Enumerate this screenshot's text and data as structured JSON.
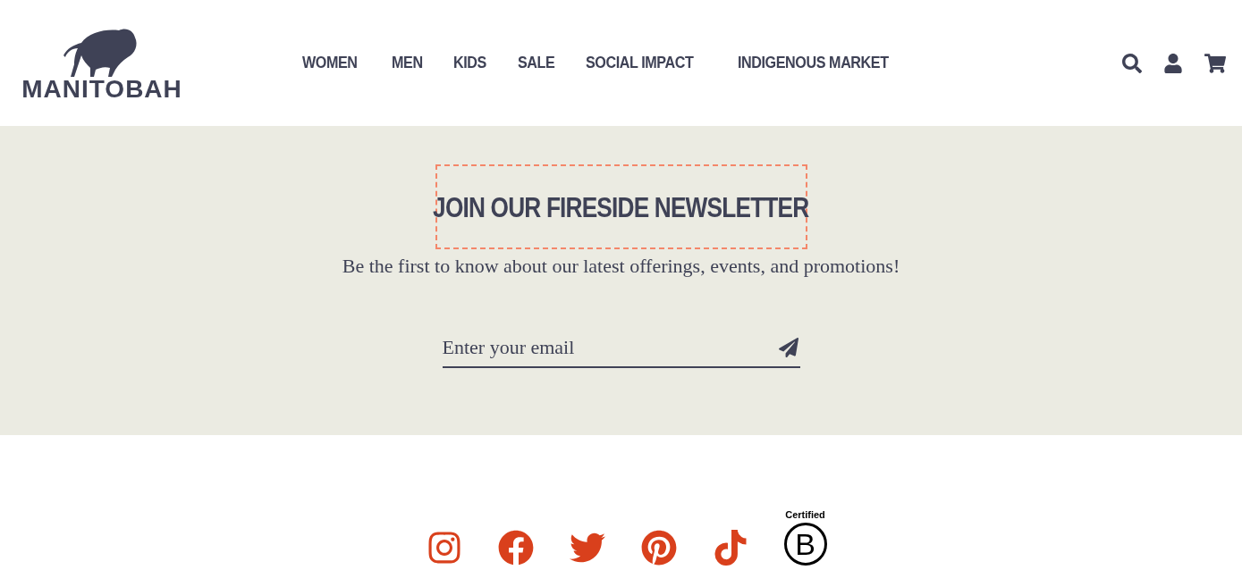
{
  "header": {
    "logo": "MANITOBAH",
    "nav": [
      {
        "label": "WOMEN"
      },
      {
        "label": "MEN"
      },
      {
        "label": "KIDS"
      },
      {
        "label": "SALE"
      },
      {
        "label": "SOCIAL IMPACT"
      },
      {
        "label": "INDIGENOUS MARKET"
      }
    ]
  },
  "newsletter": {
    "title": "JOIN OUR FIRESIDE NEWSLETTER",
    "focused": true,
    "text": "Be the first to know about our latest offerings, events, and promotions!",
    "email": {
      "placeholder": "Enter your email"
    }
  },
  "footer": {
    "socials": [
      {
        "kind": "instagram"
      },
      {
        "kind": "facebook"
      },
      {
        "kind": "twitter"
      },
      {
        "kind": "pinterest"
      },
      {
        "kind": "tiktok"
      }
    ],
    "certification": {
      "label": "Certified",
      "letter": "B"
    }
  }
}
